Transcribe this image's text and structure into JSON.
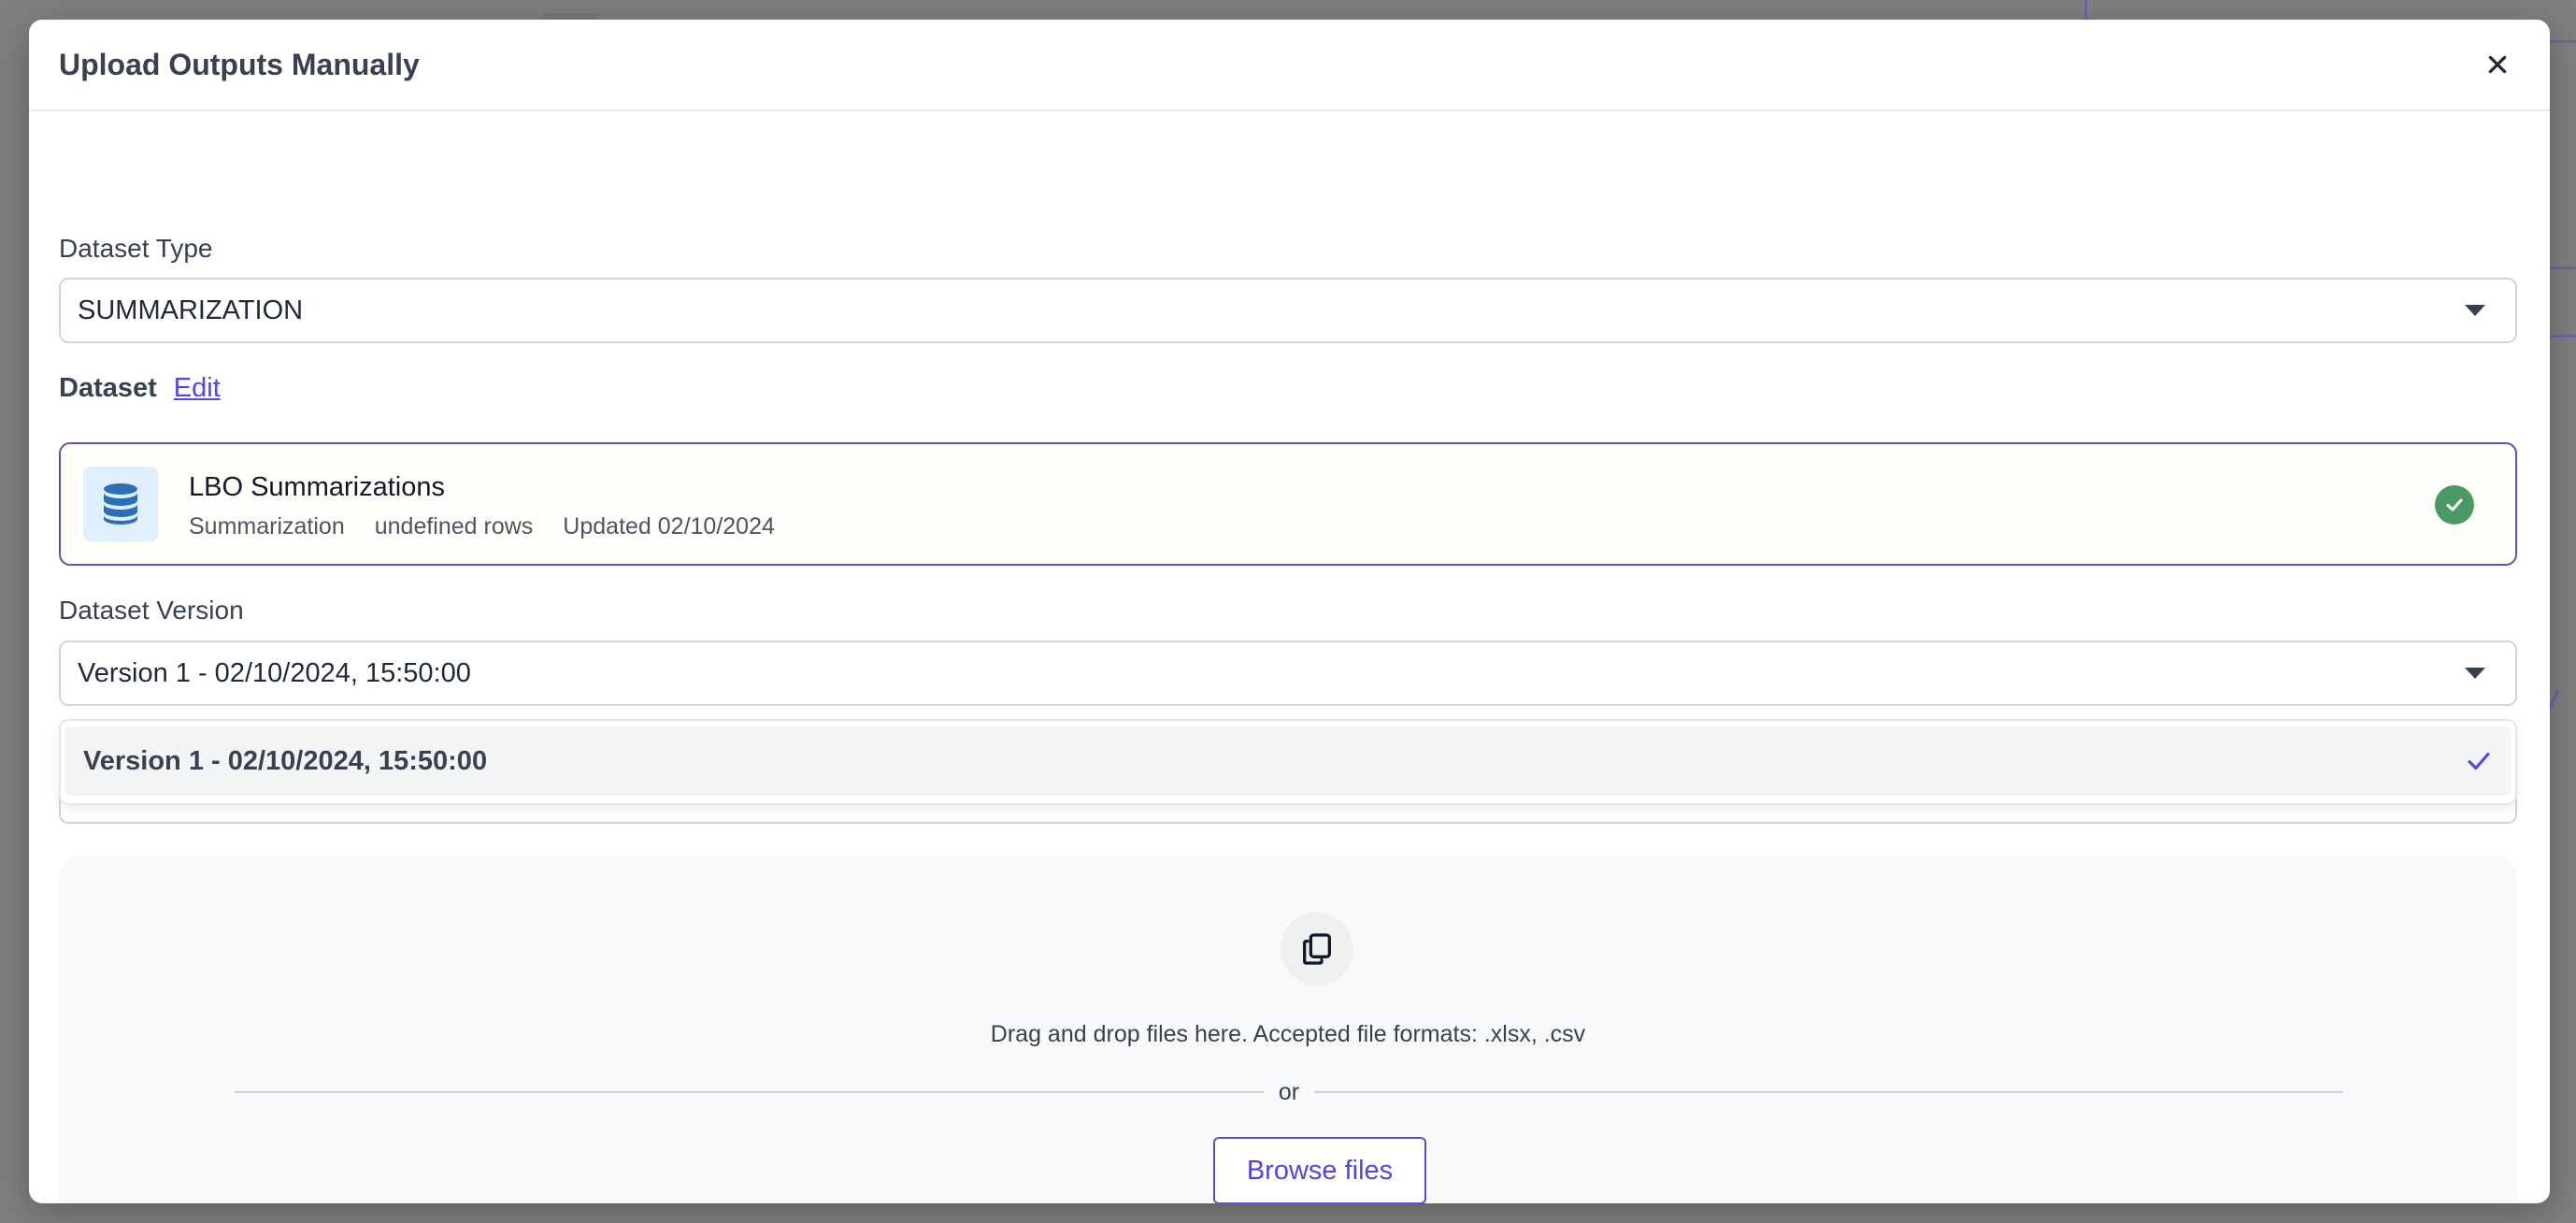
{
  "modal": {
    "title": "Upload Outputs Manually"
  },
  "dataset_type": {
    "label": "Dataset Type",
    "value": "SUMMARIZATION"
  },
  "dataset": {
    "label": "Dataset",
    "edit_label": "Edit",
    "card": {
      "name": "LBO Summarizations",
      "type": "Summarization",
      "rows": "undefined rows",
      "updated": "Updated 02/10/2024",
      "selected": true
    }
  },
  "dataset_version": {
    "label": "Dataset Version",
    "value": "Version 1 - 02/10/2024, 15:50:00",
    "options": [
      {
        "label": "Version 1 - 02/10/2024, 15:50:00",
        "selected": true
      }
    ]
  },
  "upload": {
    "drop_text": "Drag and drop files here. Accepted file formats: .xlsx, .csv",
    "or_text": "or",
    "browse_label": "Browse files"
  },
  "colors": {
    "accent": "#4f46e5",
    "success": "#4a9a66",
    "overlay": "#7f7f7f"
  },
  "icons": [
    "close-icon",
    "database-icon",
    "check-circle-icon",
    "caret-down-icon",
    "checkmark-icon",
    "copy-icon"
  ]
}
